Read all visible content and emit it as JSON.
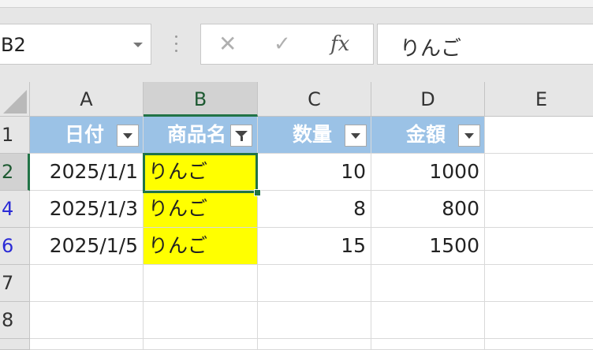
{
  "formula_bar": {
    "name_box": "B2",
    "cancel_symbol": "✕",
    "enter_symbol": "✓",
    "fx_symbol": "fx",
    "formula_value": "りんご"
  },
  "columns": [
    "A",
    "B",
    "C",
    "D",
    "E"
  ],
  "selected_column": "B",
  "rows": [
    "1",
    "2",
    "4",
    "6",
    "7",
    "8"
  ],
  "table": {
    "headers": [
      "日付",
      "商品名",
      "数量",
      "金額"
    ],
    "filter_active_column": "商品名",
    "data": [
      {
        "row": "2",
        "date": "2025/1/1",
        "product": "りんご",
        "qty": "10",
        "amount": "1000"
      },
      {
        "row": "4",
        "date": "2025/1/3",
        "product": "りんご",
        "qty": "8",
        "amount": "800"
      },
      {
        "row": "6",
        "date": "2025/1/5",
        "product": "りんご",
        "qty": "15",
        "amount": "1500"
      }
    ]
  },
  "colors": {
    "header_fill": "#9bc2e6",
    "highlight_fill": "#ffff00",
    "selection_accent": "#217346",
    "filtered_row_number": "#2b2bd6"
  },
  "icons": {
    "filter_dropdown": "chevron-down-icon",
    "filter_applied": "funnel-icon"
  }
}
